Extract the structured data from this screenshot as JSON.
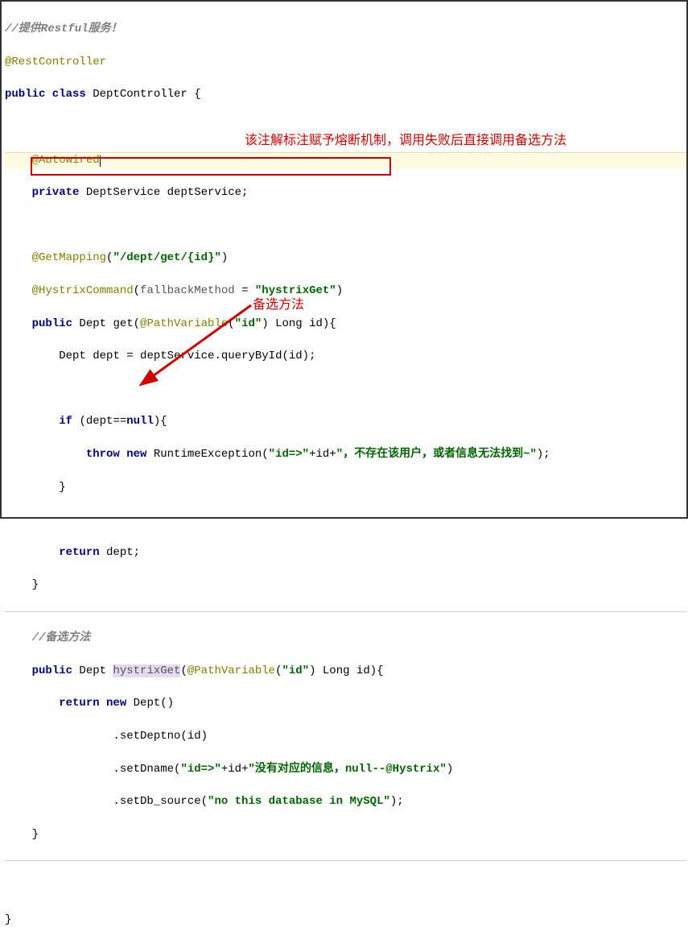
{
  "annotations": {
    "top_red": "该注解标注赋予熔断机制，调用失败后直接调用备选方法",
    "mid_red": "备选方法"
  },
  "code": {
    "l1_comment": "//提供Restful服务！",
    "l2_rest": "@RestController",
    "l3": {
      "kw1": "public class ",
      "cls": "DeptController ",
      "brace": "{"
    },
    "l4": "",
    "l5_auto": "@Autowired",
    "l6": {
      "kw": "private ",
      "type": "DeptService deptService;"
    },
    "l7": "",
    "l8": {
      "anno": "@GetMapping",
      "open": "(",
      "str": "\"/dept/get/{id}\"",
      "close": ")"
    },
    "l9": {
      "anno": "@HystrixCommand",
      "open": "(",
      "attr": "fallbackMethod ",
      "eq": "= ",
      "str": "\"hystrixGet\"",
      "close": ")"
    },
    "l10": {
      "kw": "public ",
      "type": "Dept ",
      "name": "get(",
      "pv": "@PathVariable",
      "pvopen": "(",
      "pvstr": "\"id\"",
      "pvclose": ") ",
      "arg": "Long id){"
    },
    "l11": {
      "type": "Dept ",
      "rest": "dept = deptService.queryById(id);"
    },
    "l12": "",
    "l13": {
      "kw": "if ",
      "rest": "(dept==",
      "nul": "null",
      "close": "){"
    },
    "l14": {
      "kw": "throw new ",
      "ex": "RuntimeException(",
      "s1": "\"id=>\"",
      "p1": "+id+",
      "s2": "\"，不存在该用户，或者信息无法找到~\"",
      "close": ");"
    },
    "l15": "}",
    "l16": "",
    "l17": {
      "kw": "return ",
      "rest": "dept;"
    },
    "l18": "}",
    "l19": "",
    "l20_comment": "//备选方法",
    "l21": {
      "kw": "public ",
      "type": "Dept ",
      "name": "hystrixGet",
      "open": "(",
      "pv": "@PathVariable",
      "pvopen": "(",
      "pvstr": "\"id\"",
      "pvclose": ") ",
      "arg": "Long id){"
    },
    "l22": {
      "kw": "return new ",
      "type": "Dept()"
    },
    "l23": {
      "m": ".setDeptno(id)"
    },
    "l24": {
      "m": ".setDname(",
      "s1": "\"id=>\"",
      "p1": "+id+",
      "s2": "\"没有对应的信息，null--@Hystrix\"",
      "close": ")"
    },
    "l25": {
      "m": ".setDb_source(",
      "s1": "\"no this database in MySQL\"",
      "close": ");"
    },
    "l26": "}",
    "l27": "",
    "l28": "}"
  }
}
